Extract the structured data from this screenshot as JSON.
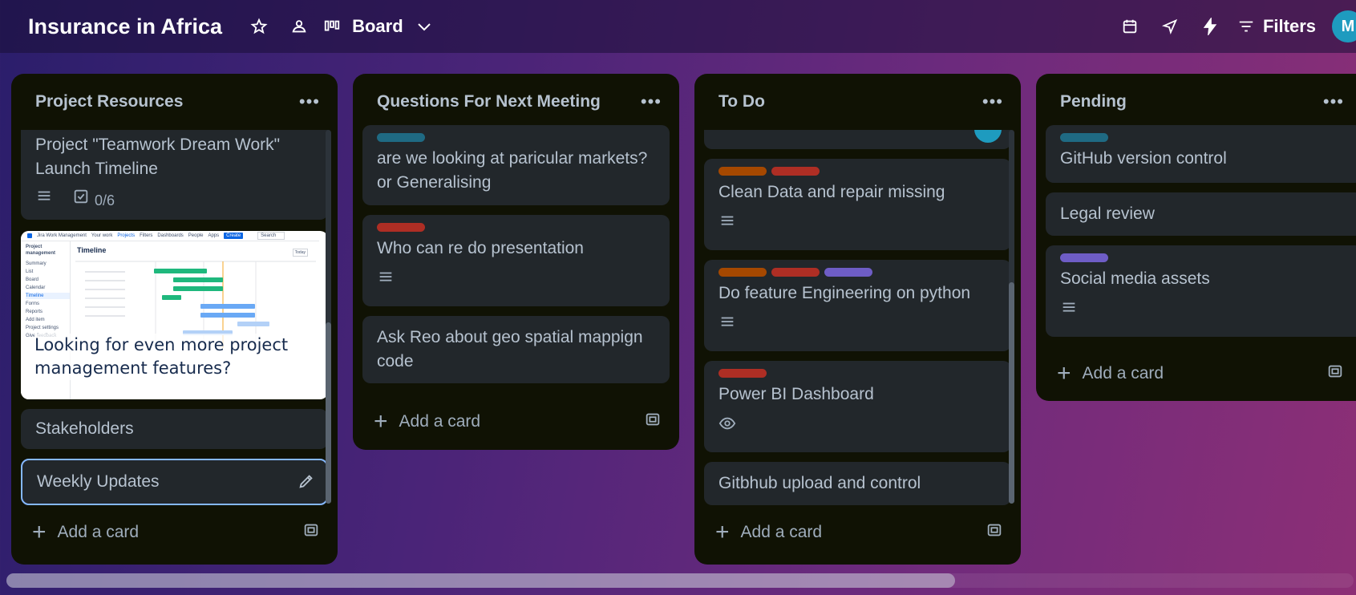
{
  "board": {
    "title": "Insurance in Africa",
    "view_label": "Board"
  },
  "toolbar": {
    "filters_label": "Filters",
    "avatar_initial": "M"
  },
  "lists": [
    {
      "title": "Project Resources",
      "cards": [
        {
          "text": "Project \"Teamwork Dream Work\" Launch Timeline",
          "checklist": "0/6"
        },
        {
          "cover_text": "Looking for even more project management features?",
          "cover_ui": {
            "app": "Jira Work Management",
            "nav": [
              "Your work",
              "Projects",
              "Filters",
              "Dashboards",
              "People",
              "Apps"
            ],
            "create": "Create",
            "search": "Search",
            "project": "Project management",
            "heading": "Timeline",
            "today": "Today",
            "sidebar": [
              "Summary",
              "List",
              "Board",
              "Calendar",
              "Timeline",
              "Forms",
              "Reports",
              "Add item",
              "Project settings",
              "Give feedback"
            ]
          }
        },
        {
          "text": "Stakeholders"
        },
        {
          "text": "Weekly Updates"
        }
      ],
      "add_label": "Add a card"
    },
    {
      "title": "Questions For Next Meeting",
      "cards": [
        {
          "text": "are we looking at paricular markets? or Generalising"
        },
        {
          "text": "Who can re do presentation"
        },
        {
          "text": "Ask Reo about geo spatial mappign code"
        }
      ],
      "add_label": "Add a card"
    },
    {
      "title": "To Do",
      "cards": [
        {
          "text": "Clean Data and repair missing"
        },
        {
          "text": "Do feature Engineering on python"
        },
        {
          "text": "Power BI Dashboard"
        },
        {
          "text": "Gitbhub upload and control"
        }
      ],
      "add_label": "Add a card"
    },
    {
      "title": "Pending",
      "cards": [
        {
          "text": "GitHub version control"
        },
        {
          "text": "Legal review"
        },
        {
          "text": "Social media assets"
        }
      ],
      "add_label": "Add a card"
    }
  ],
  "colors": {
    "teal": "#1f6a83",
    "orange": "#a54800",
    "red": "#ae2e24",
    "purple": "#6e5dc6",
    "card": "#22272b",
    "list": "#101204",
    "focus": "#85b8ff"
  }
}
